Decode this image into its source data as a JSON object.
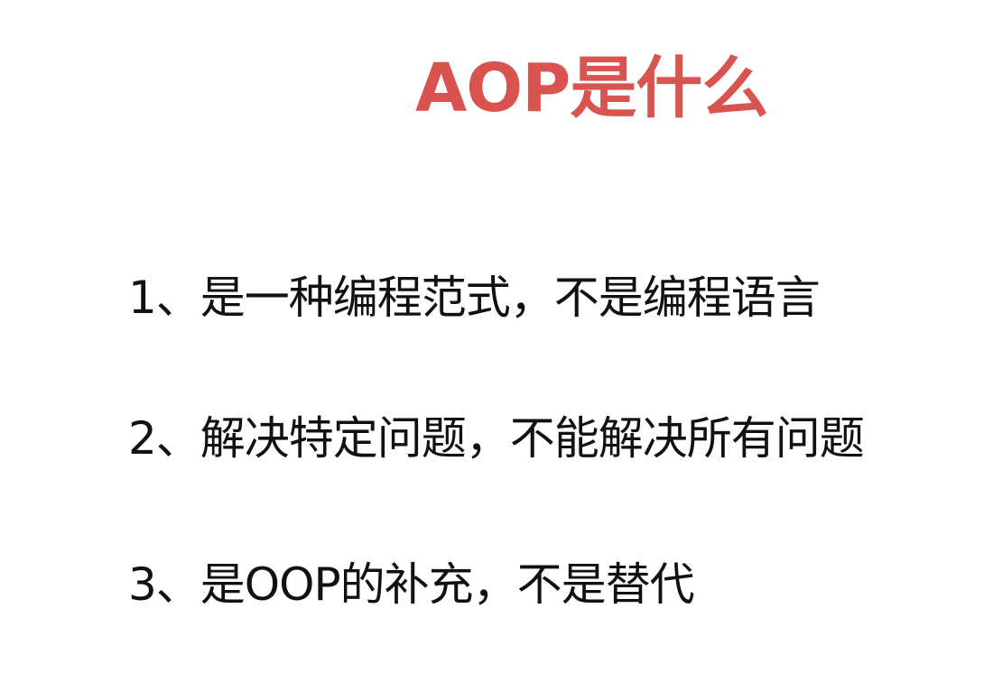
{
  "slide": {
    "title": "AOP是什么",
    "points": [
      "1、是一种编程范式，不是编程语言",
      "2、解决特定问题，不能解决所有问题",
      "3、是OOP的补充，不是替代"
    ]
  },
  "colors": {
    "title": "#d9534f",
    "text": "#111111",
    "background": "#ffffff"
  }
}
